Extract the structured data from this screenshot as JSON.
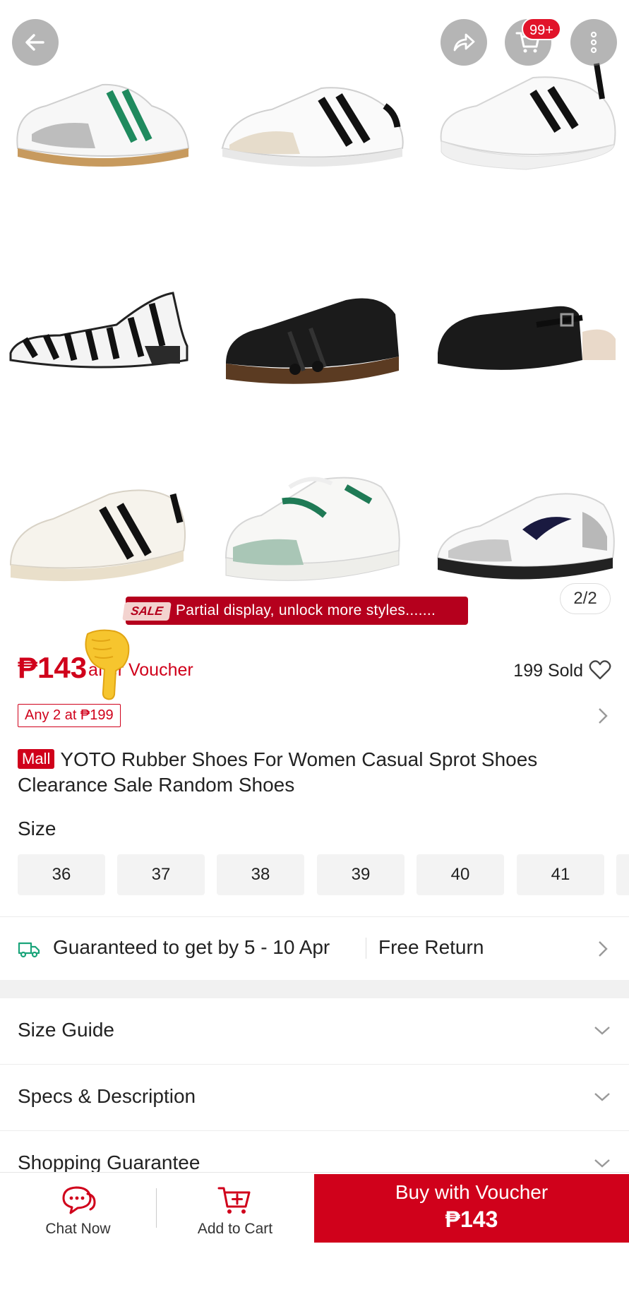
{
  "header": {
    "back_icon": "arrow-left-icon",
    "share_icon": "share-arrow-icon",
    "cart_icon": "shopping-cart-icon",
    "cart_badge": "99+",
    "more_icon": "vertical-dots-icon"
  },
  "gallery": {
    "page_indicator": "2/2",
    "shoes": [
      "white sneaker with green stripes",
      "cream sneaker with black stripes",
      "white chunky sneaker with black stripes",
      "zebra print slingback flat",
      "black tassel loafer",
      "black mary jane mule",
      "cream sneaker with black stripes",
      "white and sage green sneaker",
      "white and grey running sneaker"
    ],
    "sale_tag": "SALE",
    "sale_text": "Partial display, unlock more styles......."
  },
  "price": {
    "amount": "₱143",
    "suffix": "after Voucher",
    "sold": "199 Sold",
    "promo_tag": "Any 2 at ₱199"
  },
  "product": {
    "badge": "Mall",
    "title": "YOTO Rubber Shoes For Women Casual Sprot Shoes Clearance Sale Random Shoes"
  },
  "size": {
    "label": "Size",
    "options": [
      "36",
      "37",
      "38",
      "39",
      "40",
      "41"
    ]
  },
  "delivery": {
    "text": "Guaranteed to get by 5 - 10 Apr",
    "return": "Free Return"
  },
  "sections": {
    "size_guide": "Size Guide",
    "specs": "Specs & Description",
    "guarantee": "Shopping Guarantee"
  },
  "bottom_bar": {
    "chat": "Chat Now",
    "add_to_cart": "Add to Cart",
    "buy_line1": "Buy with Voucher",
    "buy_line2": "₱143"
  },
  "colors": {
    "brand_red": "#d0011b",
    "sale_banner": "#b5001d"
  }
}
